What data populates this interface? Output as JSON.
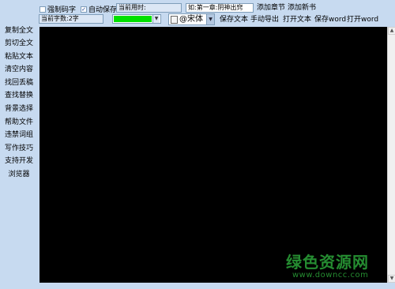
{
  "toolbar_row1": {
    "force_code_label": "强制码字",
    "auto_save_label": "自动保存",
    "time_used_label": "当前用时:",
    "chapter_input_value": "如:第一章:阴神出窍",
    "add_chapter": "添加章节",
    "add_book": "添加新书"
  },
  "toolbar_row2": {
    "word_count": "当前字数:2字",
    "text_color": "#00e000",
    "font_name": "@宋体",
    "save_text": "保存文本",
    "manual_export": "手动导出",
    "open_text": "打开文本",
    "save_word": "保存word",
    "open_word": "打开word"
  },
  "sidebar": {
    "items": [
      "复制全文",
      "剪切全文",
      "粘贴文本",
      "清空内容",
      "找回丢稿",
      "查找替换",
      "背景选择",
      "帮助文件",
      "违禁词组",
      "写作技巧",
      "支持开发",
      "浏览器"
    ]
  },
  "editor": {
    "background": "#000000"
  },
  "watermark": {
    "logo": "绿色资源网",
    "url": "www.downcc.com"
  }
}
